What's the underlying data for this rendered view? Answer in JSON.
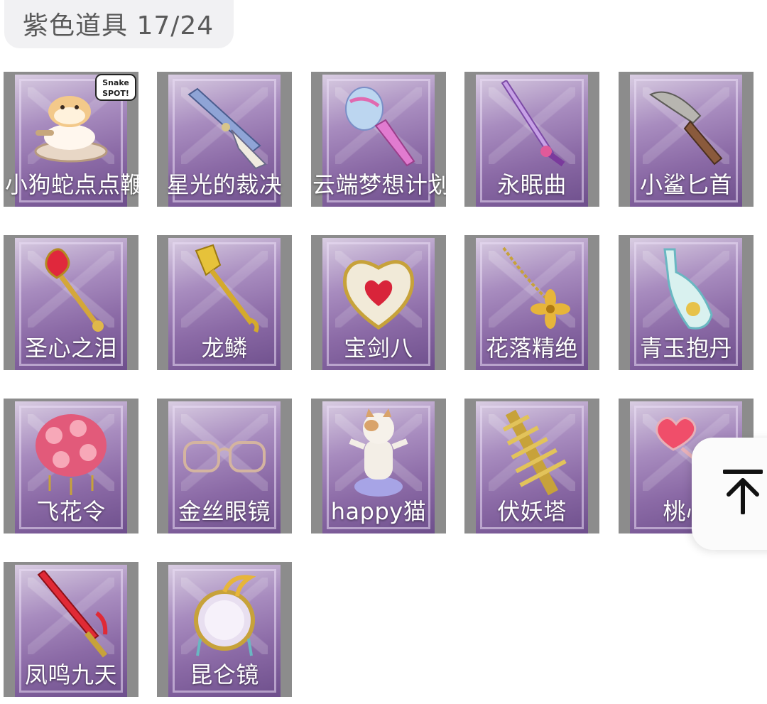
{
  "header": {
    "title": "紫色道具 17/24"
  },
  "items": [
    {
      "name": "小狗蛇点点鞭",
      "icon": "snake-ring-icon",
      "badge": "Snake SPOT!"
    },
    {
      "name": "星光的裁决",
      "icon": "musket-icon"
    },
    {
      "name": "云端梦想计划",
      "icon": "ice-cream-scepter-icon"
    },
    {
      "name": "永眠曲",
      "icon": "purple-sword-icon"
    },
    {
      "name": "小鲨匕首",
      "icon": "shark-dagger-icon"
    },
    {
      "name": "圣心之泪",
      "icon": "heart-scepter-icon"
    },
    {
      "name": "龙鳞",
      "icon": "golden-shovel-icon"
    },
    {
      "name": "宝剑八",
      "icon": "heart-shield-icon"
    },
    {
      "name": "花落精绝",
      "icon": "golden-flower-chain-icon"
    },
    {
      "name": "青玉抱丹",
      "icon": "jade-vase-icon"
    },
    {
      "name": "飞花令",
      "icon": "flower-bouquet-icon"
    },
    {
      "name": "金丝眼镜",
      "icon": "glasses-icon"
    },
    {
      "name": "happy猫",
      "icon": "cat-figurine-icon"
    },
    {
      "name": "伏妖塔",
      "icon": "pagoda-icon"
    },
    {
      "name": "桃心",
      "icon": "heart-wand-icon"
    },
    {
      "name": "凤鸣九天",
      "icon": "red-sword-icon"
    },
    {
      "name": "昆仑镜",
      "icon": "ornate-mirror-icon"
    }
  ],
  "back_to_top": {
    "icon": "arrow-up-to-top-icon"
  }
}
